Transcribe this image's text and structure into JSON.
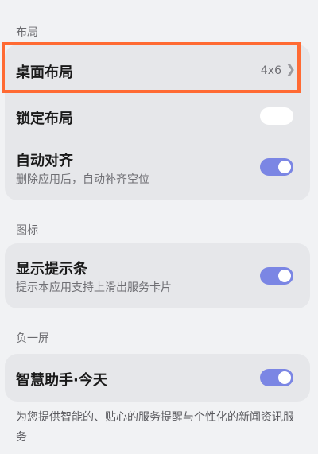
{
  "sections": {
    "layout_title": "布局",
    "icon_title": "图标",
    "negative_screen_title": "负一屏"
  },
  "layout_card": {
    "desktop_layout": {
      "label": "桌面布局",
      "value": "4x6",
      "chevron": "chevron-right-icon"
    },
    "lock_layout": {
      "label": "锁定布局",
      "toggle": "off"
    },
    "auto_align": {
      "label": "自动对齐",
      "sub": "删除应用后，自动补齐空位",
      "toggle": "on"
    }
  },
  "icon_card": {
    "show_tip_bar": {
      "label": "显示提示条",
      "sub": "提示本应用支持上滑出服务卡片",
      "toggle": "on"
    }
  },
  "negative_card": {
    "assistant_today": {
      "label": "智慧助手·今天",
      "toggle": "on"
    }
  },
  "footer": {
    "description": "为您提供智能的、贴心的服务提醒与个性化的新闻资讯服务"
  },
  "colors": {
    "highlight_border": "#ff6a33",
    "toggle_on": "#7b86e4",
    "background": "#f1f2f4",
    "card": "#e6e7ea"
  }
}
